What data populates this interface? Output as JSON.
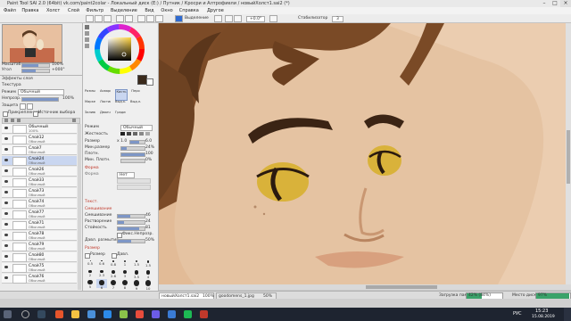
{
  "app": {
    "title": "Paint Tool SAI 2.0 (64bit) vk.com/paint2colar - Локальный диск (E:) / Путник / Кросри и Алтрофиели / новыйХолст1.sai2 (*)"
  },
  "menu": [
    "Файл",
    "Правка",
    "Холст",
    "Слой",
    "Фильтр",
    "Выделение",
    "Вид",
    "Окно",
    "Справка",
    "Другое"
  ],
  "toolbar": {
    "selection_label": "Выделение",
    "zoom_value": "+0.0°",
    "stabilizer_label": "Стабилизатор",
    "stabilizer_value": "3"
  },
  "navigator": {
    "scale_label": "Масштаб",
    "scale_value": "100%",
    "angle_label": "Угол",
    "angle_value": "+000°"
  },
  "layer_panel": {
    "effects_label": "Эффекты слоя",
    "texture_label": "Текстура",
    "mode_label": "Режим",
    "mode_value": "Обычный",
    "opacity_label": "Непрозр.",
    "opacity_value": "100%",
    "opacity_fraction": 1.0,
    "lock_label": "Защита",
    "clipping_label": "Прикрепление",
    "selection_source_label": "Источник выбора",
    "layers": [
      {
        "name": "Обычный",
        "mode": "100%"
      },
      {
        "name": "Слой12",
        "mode": "Обычный"
      },
      {
        "name": "Слой7",
        "mode": "Обычный"
      },
      {
        "name": "Слой24",
        "mode": "Обычный"
      },
      {
        "name": "Слой26",
        "mode": "Обычный"
      },
      {
        "name": "Слой33",
        "mode": "Обычный"
      },
      {
        "name": "Слой73",
        "mode": "Обычный"
      },
      {
        "name": "Слой74",
        "mode": "Обычный"
      },
      {
        "name": "Слой77",
        "mode": "Обычный"
      },
      {
        "name": "Слой71",
        "mode": "Обычный"
      },
      {
        "name": "Слой78",
        "mode": "Обычный"
      },
      {
        "name": "Слой79",
        "mode": "Обычный"
      },
      {
        "name": "Слой80",
        "mode": "Обычный"
      },
      {
        "name": "Слой75",
        "mode": "Обычный"
      },
      {
        "name": "Слой76",
        "mode": "Обычный"
      }
    ]
  },
  "color_panel": {
    "current_color": "#3a2a1c",
    "secondary_color": "#ffffff"
  },
  "tools": [
    [
      "Размытие",
      "Акварель",
      "Кисть",
      "Перо"
    ],
    [
      "Маркер",
      "Ластик",
      "Выд.к.",
      "Выд.л."
    ],
    [
      "Заливка",
      "Двоичн.",
      "Градиент",
      ""
    ]
  ],
  "brush_settings": {
    "mode_label": "Режим",
    "mode_value": "Обычный",
    "hardness_label": "Жесткость",
    "size_label": "Размер",
    "size_multiplier": "x 1.0",
    "size_value": "6.0",
    "min_size_label": "Мин.размер",
    "min_size_value": "24%",
    "min_size_fraction": 0.24,
    "density_label": "Плотн.",
    "density_value": "100",
    "density_fraction": 1.0,
    "min_density_label": "Мин. Плотн.",
    "min_density_value": "0%",
    "shape_label": "Форма",
    "shape_value": "Нет",
    "texture_label": "Текст.",
    "blending_label": "Смешивание",
    "blending_value": "46",
    "blending_fraction": 0.46,
    "dilution_label": "Растворение",
    "dilution_value": "24",
    "dilution_fraction": 0.24,
    "persistence_label": "Стойкость",
    "persistence_value": "81",
    "persistence_fraction": 0.81,
    "keep_opacity_label": "Фикс.Непрозр.",
    "blur_pressure_label": "Давл. размытия",
    "blur_pressure_value": "50%",
    "blur_pressure_fraction": 0.5,
    "size_presets_label": "Размер",
    "pressure_label": "Давл.",
    "size_presets": [
      "0.5",
      "0.6",
      "0.8",
      "1",
      "1.5",
      "1.5",
      "2",
      "2.3",
      "2.6",
      "3",
      "3.5",
      "4",
      "5",
      "6",
      "7",
      "8",
      "9",
      "10"
    ]
  },
  "canvas_tabs": [
    {
      "name": "новыйХолст1.sai2",
      "zoom": "100%"
    },
    {
      "name": "goodomens_1.jpg",
      "zoom": "50%"
    }
  ],
  "status_bar": {
    "memory_label": "Загрузка памяти",
    "memory_value": "42% (84%)",
    "memory_fraction": 0.42,
    "disk_label": "Место диска",
    "disk_value": "97%",
    "disk_fraction": 0.97
  },
  "taskbar": {
    "language": "РУС",
    "time": "15:23",
    "date": "15.08.2019"
  }
}
